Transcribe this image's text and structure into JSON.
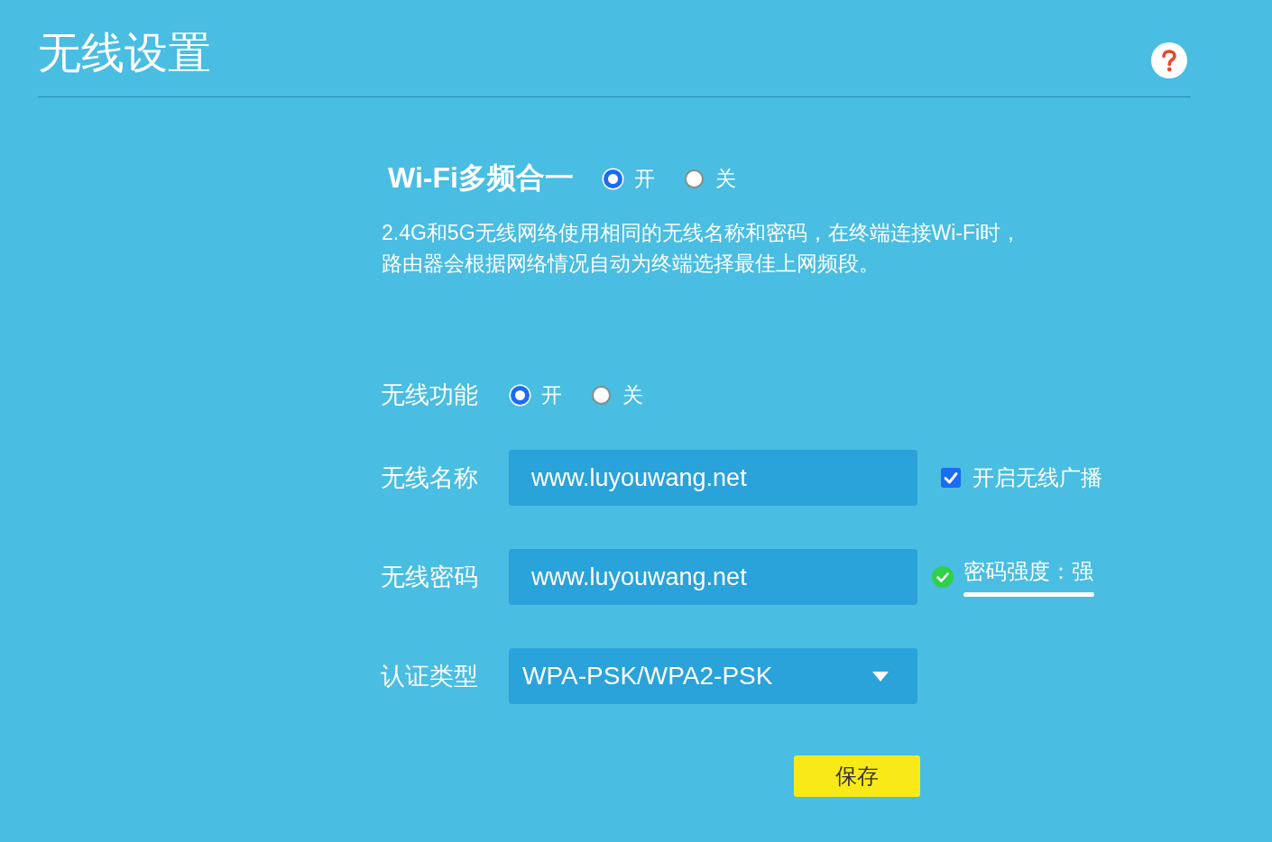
{
  "page": {
    "title": "无线设置"
  },
  "multi_band": {
    "label": "Wi-Fi多频合一",
    "options": [
      {
        "label": "开",
        "selected": true
      },
      {
        "label": "关",
        "selected": false
      }
    ],
    "description": [
      "2.4G和5G无线网络使用相同的无线名称和密码，在终端连接Wi-Fi时，",
      "路由器会根据网络情况自动为终端选择最佳上网频段。"
    ]
  },
  "wireless": {
    "label": "无线功能",
    "options": [
      {
        "label": "开",
        "selected": true
      },
      {
        "label": "关",
        "selected": false
      }
    ]
  },
  "form": {
    "rows": [
      {
        "kind": "text",
        "label": "无线名称",
        "value": "www.luyouwang.net",
        "option": {
          "label": "开启无线广播",
          "checked": true
        }
      },
      {
        "kind": "password",
        "label": "无线密码",
        "value": "www.luyouwang.net",
        "strength": {
          "valid": true,
          "label": "密码强度：强",
          "level": 1
        }
      },
      {
        "kind": "select",
        "label": "认证类型",
        "value": "WPA-PSK/WPA2-PSK"
      }
    ]
  },
  "save_button": {
    "label": "保存"
  }
}
